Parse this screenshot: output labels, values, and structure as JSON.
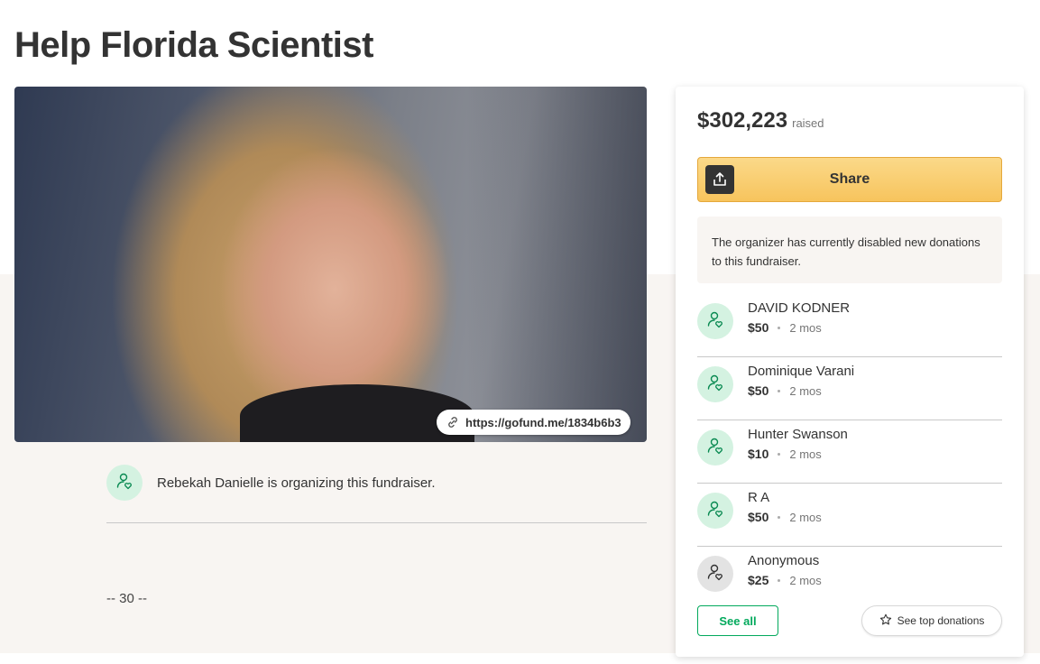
{
  "page": {
    "title": "Help Florida Scientist"
  },
  "hero": {
    "image_icon": "portrait-photo",
    "link_icon": "link-icon",
    "short_link": "https://gofund.me/1834b6b3"
  },
  "organizer": {
    "icon": "user-heart-icon",
    "text": "Rebekah Danielle is organizing this fundraiser."
  },
  "story": {
    "text": "-- 30 --"
  },
  "sidebar": {
    "raised_amount": "$302,223",
    "raised_label": "raised",
    "share_label": "Share",
    "share_icon": "upload-share-icon",
    "notice": "The organizer has currently disabled new donations to this fundraiser.",
    "donations": [
      {
        "name": "DAVID KODNER",
        "amount": "$50",
        "time": "2 mos",
        "avatar_color": "#d4f2e1"
      },
      {
        "name": "Dominique Varani",
        "amount": "$50",
        "time": "2 mos",
        "avatar_color": "#d4f2e1"
      },
      {
        "name": "Hunter Swanson",
        "amount": "$10",
        "time": "2 mos",
        "avatar_color": "#d4f2e1"
      },
      {
        "name": "R A",
        "amount": "$50",
        "time": "2 mos",
        "avatar_color": "#d4f2e1"
      },
      {
        "name": "Anonymous",
        "amount": "$25",
        "time": "2 mos",
        "avatar_color": "#e3e3e3"
      }
    ],
    "see_all_label": "See all",
    "see_top_label": "See top donations",
    "see_top_icon": "star-icon"
  },
  "colors": {
    "brand_green": "#02a95c",
    "share_yellow": "#f7c45d",
    "text_dark": "#333333"
  }
}
